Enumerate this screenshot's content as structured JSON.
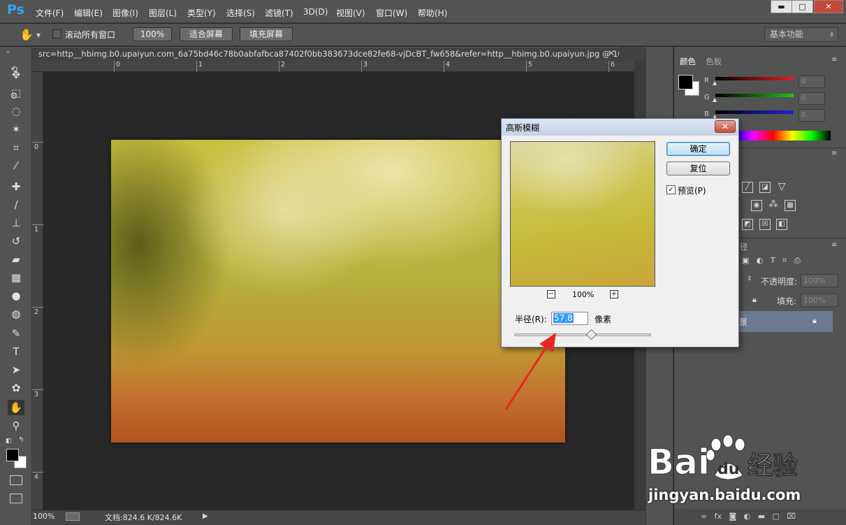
{
  "app": {
    "logo": "Ps"
  },
  "menu": [
    "文件(F)",
    "编辑(E)",
    "图像(I)",
    "图层(L)",
    "类型(Y)",
    "选择(S)",
    "滤镜(T)",
    "3D(D)",
    "视图(V)",
    "窗口(W)",
    "帮助(H)"
  ],
  "window_controls": {
    "minimize": "▬",
    "maximize": "□",
    "close": "✕"
  },
  "options_bar": {
    "scroll_all_label": "滚动所有窗口",
    "zoom_100": "100%",
    "fit_screen": "适合屏幕",
    "fill_screen": "填充屏幕",
    "workspace": "基本功能"
  },
  "document": {
    "tab_title": "src=http__hbimg.b0.upaiyun.com_6a75bd46c78b0abfafbca87402f0bb383673dce82fe68-vjDcBT_fw658&refer=http__hbimg.b0.upaiyun.jpg @ 100...",
    "ruler_top_labels": [
      "0",
      "1",
      "2",
      "3",
      "4",
      "5",
      "6"
    ],
    "ruler_left_labels": [
      "0",
      "1",
      "2",
      "3",
      "4"
    ]
  },
  "status": {
    "zoom": "100%",
    "doc_size": "文档:824.6 K/824.6K",
    "arrow": "▶"
  },
  "tools": [
    {
      "name": "move-tool",
      "glyph": "✥"
    },
    {
      "name": "marquee-tool",
      "glyph": "⬚"
    },
    {
      "name": "lasso-tool",
      "glyph": "◌"
    },
    {
      "name": "magic-wand-tool",
      "glyph": "✶"
    },
    {
      "name": "crop-tool",
      "glyph": "⌗"
    },
    {
      "name": "eyedropper-tool",
      "glyph": "⁄"
    },
    {
      "name": "healing-tool",
      "glyph": "✚"
    },
    {
      "name": "brush-tool",
      "glyph": "∕"
    },
    {
      "name": "stamp-tool",
      "glyph": "⊥"
    },
    {
      "name": "history-brush-tool",
      "glyph": "↺"
    },
    {
      "name": "eraser-tool",
      "glyph": "▰"
    },
    {
      "name": "gradient-tool",
      "glyph": "▦"
    },
    {
      "name": "blur-tool",
      "glyph": "●"
    },
    {
      "name": "dodge-tool",
      "glyph": "◍"
    },
    {
      "name": "pen-tool",
      "glyph": "✎"
    },
    {
      "name": "type-tool",
      "glyph": "T"
    },
    {
      "name": "path-select-tool",
      "glyph": "➤"
    },
    {
      "name": "shape-tool",
      "glyph": "✿"
    },
    {
      "name": "hand-tool",
      "glyph": "✋"
    },
    {
      "name": "zoom-tool",
      "glyph": "⚲"
    }
  ],
  "color_panel": {
    "tab_color": "颜色",
    "tab_swatches": "色板",
    "channels": [
      {
        "label": "R",
        "value": "0",
        "color": "#e0201e"
      },
      {
        "label": "G",
        "value": "0",
        "color": "#22c21e"
      },
      {
        "label": "B",
        "value": "0",
        "color": "#1f22d8"
      }
    ]
  },
  "layers_panel": {
    "tab_paths": "径",
    "opacity_label": "不透明度:",
    "opacity_value": "100%",
    "fill_label": "填充:",
    "fill_value": "100%",
    "layer_name": "景"
  },
  "dialog": {
    "title": "高斯模糊",
    "close": "✕",
    "ok": "确定",
    "reset": "复位",
    "preview_label": "预览(P)",
    "preview_checked": "✓",
    "zoom": "100%",
    "zoom_out": "−",
    "zoom_in": "+",
    "radius_label": "半径(R):",
    "radius_value": "57.8",
    "radius_unit": "像素"
  },
  "watermark": {
    "logo_text": "Bai du 经验",
    "url": "jingyan.baidu.com"
  },
  "accent_colors": {
    "arrow": "#e8281f",
    "ps_blue": "#31a8ff"
  }
}
